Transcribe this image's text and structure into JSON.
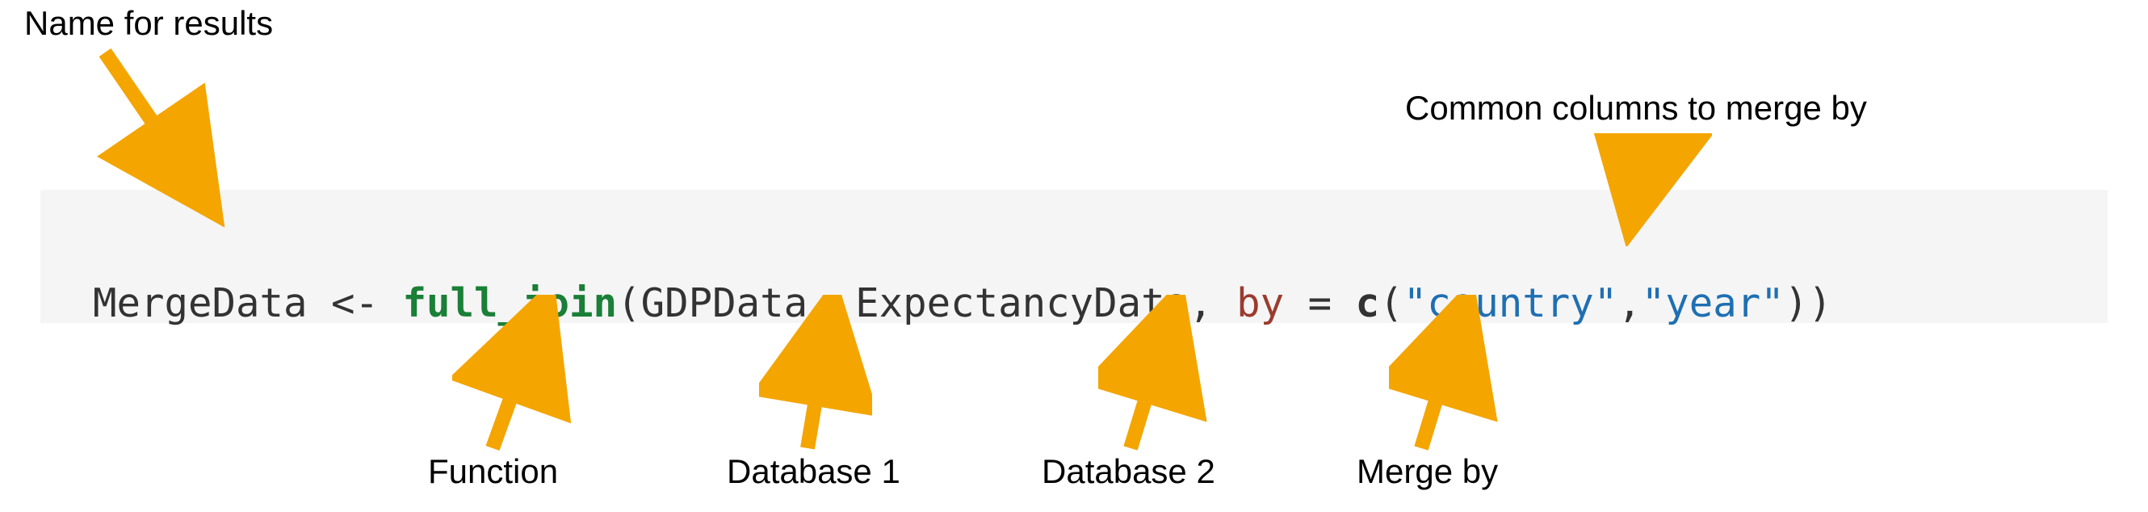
{
  "annotations": {
    "top_left": "Name for results",
    "top_right": "Common columns to merge by",
    "bottom_1": "Function",
    "bottom_2": "Database 1",
    "bottom_3": "Database 2",
    "bottom_4": "Merge by"
  },
  "code": {
    "result_var": "MergeData",
    "assign": " <- ",
    "function": "full_join",
    "open_paren": "(",
    "arg1": "GDPData",
    "sep1": ", ",
    "arg2": "ExpectancyData",
    "sep2": ", ",
    "by_kw": "by",
    "eq": " = ",
    "c_kw": "c",
    "open_paren2": "(",
    "str1": "\"country\"",
    "comma": ",",
    "str2": "\"year\"",
    "close_parens": "))"
  },
  "colors": {
    "arrow": "#f4a500"
  }
}
